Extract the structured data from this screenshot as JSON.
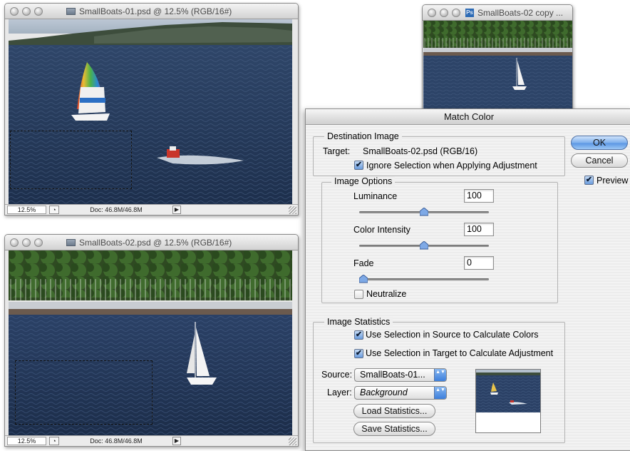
{
  "windows": [
    {
      "id": "smallboats-01",
      "title": "SmallBoats-01.psd @ 12.5% (RGB/16#)",
      "status": {
        "zoom": "12.5%",
        "doc_size": "Doc: 46.8M/46.8M"
      }
    },
    {
      "id": "smallboats-02",
      "title": "SmallBoats-02.psd @ 12.5% (RGB/16#)",
      "status": {
        "zoom": "12.5%",
        "doc_size": "Doc: 46.8M/46.8M"
      }
    },
    {
      "id": "smallboats-02-copy",
      "title": "SmallBoats-02 copy ..."
    }
  ],
  "dialog": {
    "title": "Match Color",
    "destination": {
      "label": "Destination Image",
      "target_label": "Target:",
      "target_value": "SmallBoats-02.psd (RGB/16)",
      "ignore_selection": {
        "label": "Ignore Selection when Applying Adjustment",
        "checked": true
      }
    },
    "image_options": {
      "label": "Image Options",
      "luminance": {
        "label": "Luminance",
        "value": "100",
        "slider_fraction": 0.5
      },
      "color_intensity": {
        "label": "Color Intensity",
        "value": "100",
        "slider_fraction": 0.5
      },
      "fade": {
        "label": "Fade",
        "value": "0",
        "slider_fraction": 0
      },
      "neutralize": {
        "label": "Neutralize",
        "checked": false
      }
    },
    "image_statistics": {
      "label": "Image Statistics",
      "use_selection_source": {
        "label": "Use Selection in Source to Calculate Colors",
        "checked": true
      },
      "use_selection_target": {
        "label": "Use Selection in Target to Calculate Adjustment",
        "checked": true
      },
      "source": {
        "label": "Source:",
        "value": "SmallBoats-01..."
      },
      "layer": {
        "label": "Layer:",
        "value": "Background"
      },
      "load_button": "Load Statistics...",
      "save_button": "Save Statistics..."
    },
    "buttons": {
      "ok": "OK",
      "cancel": "Cancel"
    },
    "preview": {
      "label": "Preview",
      "checked": true
    }
  },
  "icons": {
    "checkbox_checked": "✔",
    "popup_arrows": "▲▼",
    "menu_arrow": "▶",
    "history_icon": "◔"
  },
  "colors": {
    "water": "#2a3e5e",
    "forest": "#2f4a22",
    "ok_button": "#5c97e4",
    "sail_white": "#f4f4f4"
  }
}
